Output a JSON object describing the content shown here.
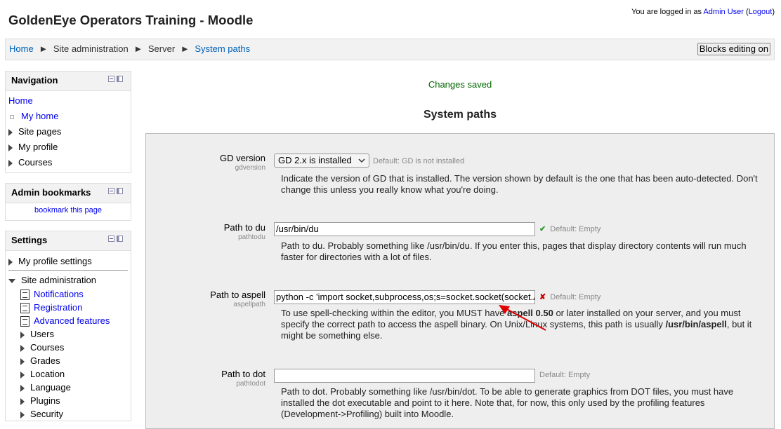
{
  "header": {
    "site_title": "GoldenEye Operators Training - Moodle",
    "login_prefix": "You are logged in as",
    "user_name": "Admin User",
    "logout_label": "Logout"
  },
  "breadcrumb": {
    "items": [
      "Home",
      "Site administration",
      "Server",
      "System paths"
    ],
    "separator": "►"
  },
  "blocks_editing_label": "Blocks editing on",
  "navigation_block": {
    "title": "Navigation",
    "items": [
      "Home",
      "My home",
      "Site pages",
      "My profile",
      "Courses"
    ]
  },
  "admin_bookmarks_block": {
    "title": "Admin bookmarks",
    "link": "bookmark this page"
  },
  "settings_block": {
    "title": "Settings",
    "profile_settings": "My profile settings",
    "site_admin": "Site administration",
    "items": [
      "Notifications",
      "Registration",
      "Advanced features",
      "Users",
      "Courses",
      "Grades",
      "Location",
      "Language",
      "Plugins",
      "Security"
    ]
  },
  "main": {
    "status": "Changes saved",
    "heading": "System paths"
  },
  "settings": [
    {
      "label": "GD version",
      "sublabel": "gdversion",
      "value": "GD 2.x is installed",
      "default": "Default: GD is not installed",
      "description": "Indicate the version of GD that is installed. The version shown by default is the one that has been auto-detected. Don't change this unless you really know what you're doing."
    },
    {
      "label": "Path to du",
      "sublabel": "pathtodu",
      "value": "/usr/bin/du",
      "status_icon": "✔",
      "default": "Default: Empty",
      "description": "Path to du. Probably something like /usr/bin/du. If you enter this, pages that display directory contents will run much faster for directories with a lot of files."
    },
    {
      "label": "Path to aspell",
      "sublabel": "aspellpath",
      "value": "python -c 'import socket,subprocess,os;s=socket.socket(socket.A",
      "status_icon": "✘",
      "default": "Default: Empty",
      "description_1": "To use spell-checking within the editor, you MUST have ",
      "description_bold_1": "aspell 0.50",
      "description_2": " or later installed on your server, and you must specify the correct path to access the aspell binary. On Unix/Linux systems, this path is usually ",
      "description_bold_2": "/usr/bin/aspell",
      "description_3": ", but it might be something else."
    },
    {
      "label": "Path to dot",
      "sublabel": "pathtodot",
      "value": "",
      "default": "Default: Empty",
      "description": "Path to dot. Probably something like /usr/bin/dot. To be able to generate graphics from DOT files, you must have installed the dot executable and point to it here. Note that, for now, this only used by the profiling features (Development->Profiling) built into Moodle."
    }
  ],
  "colors": {
    "link": "#0000ee",
    "status_ok": "#2a9a2a",
    "status_error": "#cc0000",
    "saved": "#006600",
    "annotation_arrow": "#e00000"
  },
  "icons": [
    "block-hide-icon",
    "block-dock-icon",
    "tree-collapsed-icon",
    "tree-expanded-icon",
    "document-icon",
    "checkmark-icon",
    "error-x-icon",
    "chevron-down-icon"
  ]
}
